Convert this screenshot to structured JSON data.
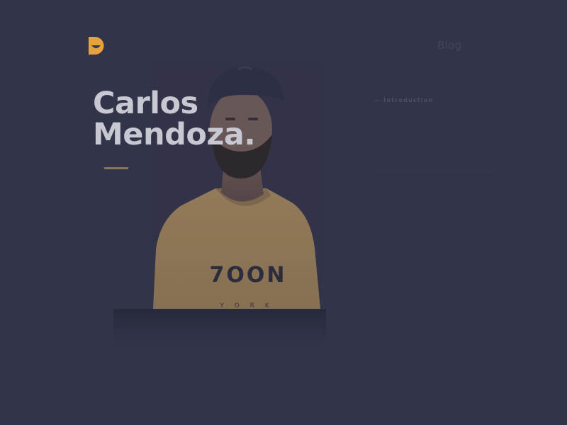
{
  "header": {
    "logo_icon": "smile-face-logo-icon",
    "accent_color": "#e6a23c",
    "nav": {
      "blog_label": "Blog"
    }
  },
  "hero": {
    "first_name": "Carlos",
    "last_name": "Mendoza.",
    "intro_label": "— Introduction",
    "shirt_print": "7OON",
    "shirt_print_sub": "Y O R K"
  },
  "colors": {
    "background": "#32344a",
    "name_text": "#c7c8d2",
    "underline": "#8a7558",
    "shirt": "#a88a5e"
  }
}
